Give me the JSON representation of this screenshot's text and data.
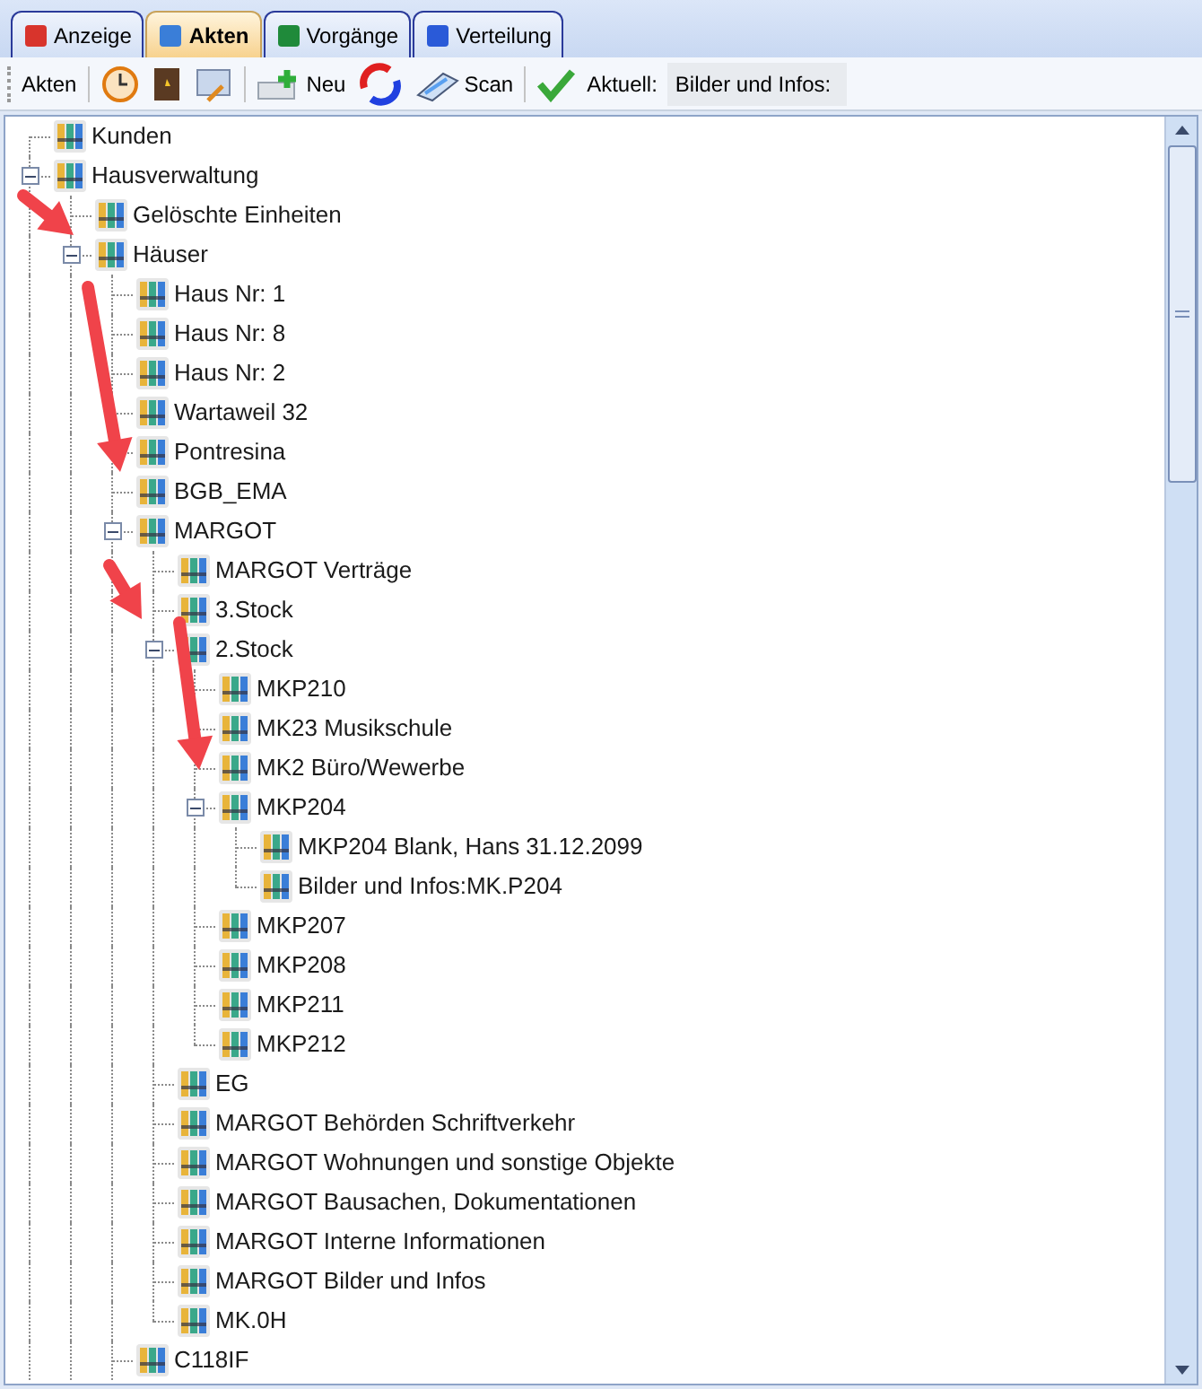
{
  "tabs": [
    {
      "label": "Anzeige",
      "selected": false
    },
    {
      "label": "Akten",
      "selected": true
    },
    {
      "label": "Vorgänge",
      "selected": false
    },
    {
      "label": "Verteilung",
      "selected": false
    }
  ],
  "toolbar": {
    "label": "Akten",
    "new_button": "Neu",
    "scan_button": "Scan",
    "current_label": "Aktuell:",
    "current_value": "Bilder und Infos:"
  },
  "tree": [
    {
      "label": "Kunden"
    },
    {
      "label": "Hausverwaltung",
      "expanded": true,
      "children": [
        {
          "label": "Gelöschte Einheiten"
        },
        {
          "label": "Häuser",
          "expanded": true,
          "children": [
            {
              "label": "Haus Nr:  1"
            },
            {
              "label": "Haus Nr:  8"
            },
            {
              "label": "Haus Nr:  2"
            },
            {
              "label": "Wartaweil 32"
            },
            {
              "label": "Pontresina"
            },
            {
              "label": "BGB_EMA"
            },
            {
              "label": "MARGOT",
              "expanded": true,
              "children": [
                {
                  "label": "MARGOT Verträge"
                },
                {
                  "label": "3.Stock"
                },
                {
                  "label": "2.Stock",
                  "expanded": true,
                  "children": [
                    {
                      "label": "MKP210"
                    },
                    {
                      "label": "MK23 Musikschule"
                    },
                    {
                      "label": "MK2 Büro/Wewerbe"
                    },
                    {
                      "label": "MKP204",
                      "expanded": true,
                      "children": [
                        {
                          "label": "MKP204 Blank, Hans 31.12.2099"
                        },
                        {
                          "label": "Bilder und Infos:MK.P204"
                        }
                      ]
                    },
                    {
                      "label": "MKP207"
                    },
                    {
                      "label": "MKP208"
                    },
                    {
                      "label": "MKP211"
                    },
                    {
                      "label": "MKP212"
                    }
                  ]
                },
                {
                  "label": "EG"
                },
                {
                  "label": "MARGOT Behörden Schriftverkehr"
                },
                {
                  "label": "MARGOT Wohnungen und sonstige Objekte"
                },
                {
                  "label": "MARGOT Bausachen, Dokumentationen"
                },
                {
                  "label": "MARGOT Interne Informationen"
                },
                {
                  "label": "MARGOT Bilder und Infos"
                },
                {
                  "label": "MK.0H"
                }
              ]
            },
            {
              "label": "C118IF"
            }
          ]
        }
      ]
    }
  ]
}
